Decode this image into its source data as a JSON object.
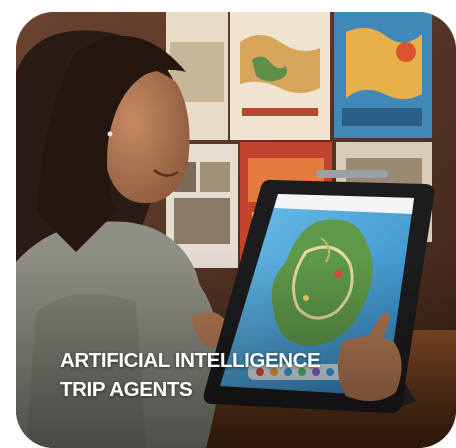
{
  "caption": {
    "line1": "ARTIFICIAL INTELLIGENCE",
    "line2": "TRIP AGENTS"
  },
  "colors": {
    "caption_text": "#ffffff",
    "wall": "#5a3a2a",
    "shirt": "#8f8f86",
    "hair": "#2a1c14",
    "tablet_frame": "#1c1c1e",
    "map_water": "#4ea7d8",
    "map_land": "#5f9a4a"
  }
}
